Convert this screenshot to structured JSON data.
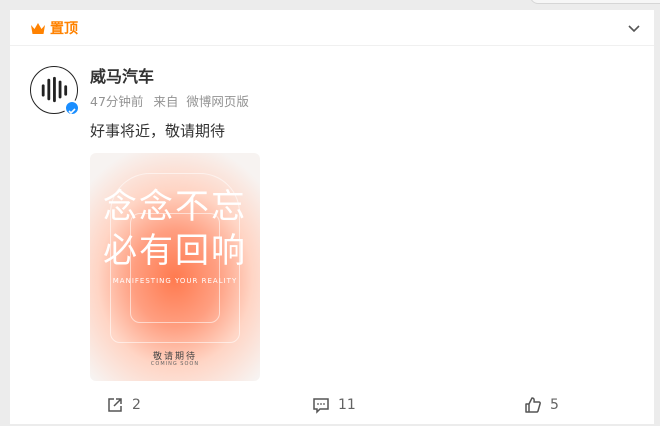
{
  "pinned": {
    "label": "置顶"
  },
  "post": {
    "author": "威马汽车",
    "time": "47分钟前",
    "source_prefix": "来自",
    "source": "微博网页版",
    "text": "好事将近，敬请期待",
    "image": {
      "line1": "念念不忘",
      "line2": "必有回响",
      "subtitle": "MANIFESTING YOUR REALITY",
      "footer_cn": "敬请期待",
      "footer_en": "COMING SOON"
    }
  },
  "actions": {
    "share_count": "2",
    "comment_count": "11",
    "like_count": "5"
  },
  "colors": {
    "accent": "#ff8200",
    "verified": "#1a8eff"
  }
}
